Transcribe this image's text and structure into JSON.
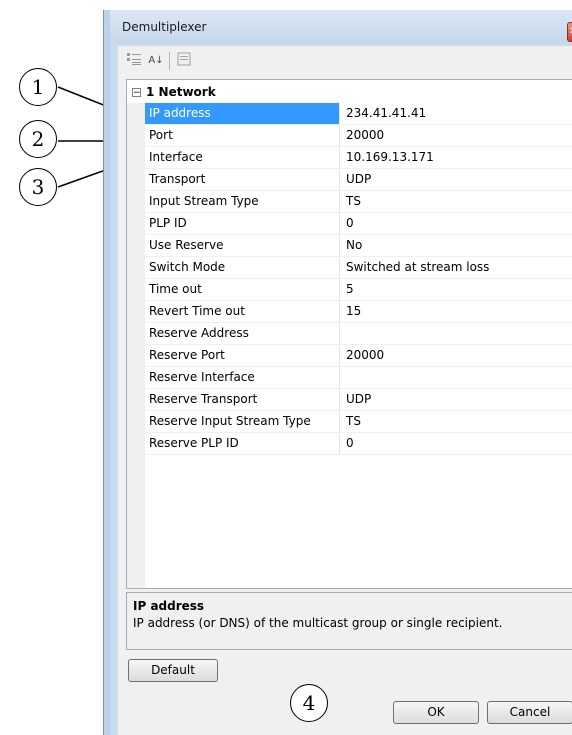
{
  "window": {
    "title": "Demultiplexer",
    "close_glyph": "✕"
  },
  "toolbar": {
    "categorized_icon": "categorized-view-icon",
    "alphabetical_icon": "alphabetical-sort-icon",
    "property_pages_icon": "property-pages-icon",
    "alphabetical_glyph": "A↓"
  },
  "grid": {
    "category": {
      "toggle": "⊟",
      "label": "1 Network"
    },
    "properties": [
      {
        "name": "IP address",
        "value": "234.41.41.41",
        "selected": true
      },
      {
        "name": "Port",
        "value": "20000"
      },
      {
        "name": "Interface",
        "value": "10.169.13.171"
      },
      {
        "name": "Transport",
        "value": "UDP"
      },
      {
        "name": "Input Stream Type",
        "value": "TS"
      },
      {
        "name": "PLP ID",
        "value": "0"
      },
      {
        "name": "Use Reserve",
        "value": "No"
      },
      {
        "name": "Switch Mode",
        "value": "Switched at stream loss"
      },
      {
        "name": "Time out",
        "value": "5"
      },
      {
        "name": "Revert Time out",
        "value": "15"
      },
      {
        "name": "Reserve Address",
        "value": ""
      },
      {
        "name": "Reserve Port",
        "value": "20000"
      },
      {
        "name": "Reserve Interface",
        "value": ""
      },
      {
        "name": "Reserve Transport",
        "value": "UDP"
      },
      {
        "name": "Reserve Input Stream Type",
        "value": "TS"
      },
      {
        "name": "Reserve PLP ID",
        "value": "0"
      }
    ]
  },
  "description": {
    "title": "IP address",
    "text": "IP address (or DNS) of the multicast group or single recipient."
  },
  "buttons": {
    "default": "Default",
    "ok": "OK",
    "cancel": "Cancel"
  },
  "callouts": [
    "1",
    "2",
    "3",
    "4"
  ],
  "colors": {
    "selection": "#3399ff",
    "frame": "#c9dbee",
    "close": "#c8432b"
  }
}
